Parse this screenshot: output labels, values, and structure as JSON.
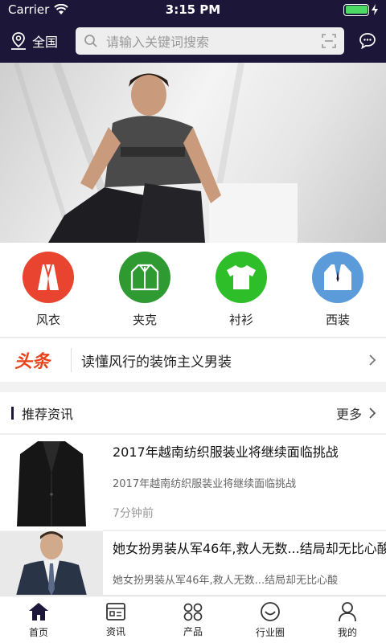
{
  "status": {
    "carrier": "Carrier",
    "time": "3:15 PM"
  },
  "header": {
    "location": "全国",
    "search_placeholder": "请输入关键词搜索"
  },
  "categories": [
    {
      "label": "风衣",
      "color": "#e8442f"
    },
    {
      "label": "夹克",
      "color": "#2f9a32"
    },
    {
      "label": "衬衫",
      "color": "#2dbe2a"
    },
    {
      "label": "西装",
      "color": "#5b9bd9"
    }
  ],
  "headline": {
    "tag": "头条",
    "text": "读懂风行的装饰主义男装"
  },
  "news": {
    "section_title": "推荐资讯",
    "more_label": "更多",
    "items": [
      {
        "title": "2017年越南纺织服装业将继续面临挑战",
        "summary": "2017年越南纺织服装业将继续面临挑战",
        "time": "7分钟前"
      },
      {
        "title": "她女扮男装从军46年,救人无数...结局却无比心酸",
        "summary": "她女扮男装从军46年,救人无数...结局却无比心酸"
      }
    ]
  },
  "tabs": [
    {
      "label": "首页"
    },
    {
      "label": "资讯"
    },
    {
      "label": "产品"
    },
    {
      "label": "行业圈"
    },
    {
      "label": "我的"
    }
  ],
  "colors": {
    "header_bg": "#1c1638",
    "accent_red": "#e8431b"
  }
}
